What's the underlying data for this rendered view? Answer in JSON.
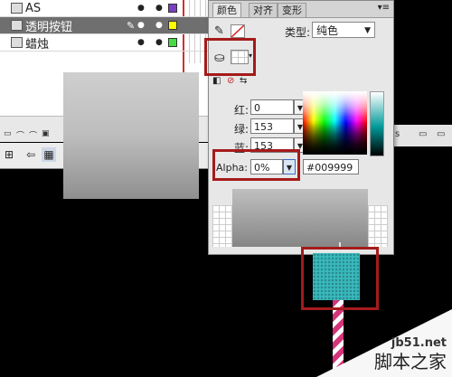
{
  "layers": [
    {
      "name": "AS",
      "selected": false,
      "swatch_color": "#7b3fc4"
    },
    {
      "name": "透明按钮",
      "selected": true,
      "swatch_color": "#ffff00"
    },
    {
      "name": "蜡烛",
      "selected": false,
      "swatch_color": "#44dd44"
    }
  ],
  "color_panel": {
    "tabs": [
      "颜色",
      "对齐",
      "变形"
    ],
    "active_tab": "颜色",
    "type_label": "类型:",
    "type_value": "纯色",
    "red_label": "红:",
    "red_value": "0",
    "green_label": "绿:",
    "green_value": "153",
    "blue_label": "蓝:",
    "blue_value": "153",
    "alpha_label": "Alpha:",
    "alpha_value": "0%",
    "hex_value": "#009999"
  },
  "right_strip": {
    "text": "s"
  },
  "watermark": {
    "site": "jb51.net",
    "name": "脚本之家"
  },
  "colors": {
    "highlight": "#a51a1a",
    "fill_teal": "#009999",
    "candle_stripe": "#d4347a"
  }
}
